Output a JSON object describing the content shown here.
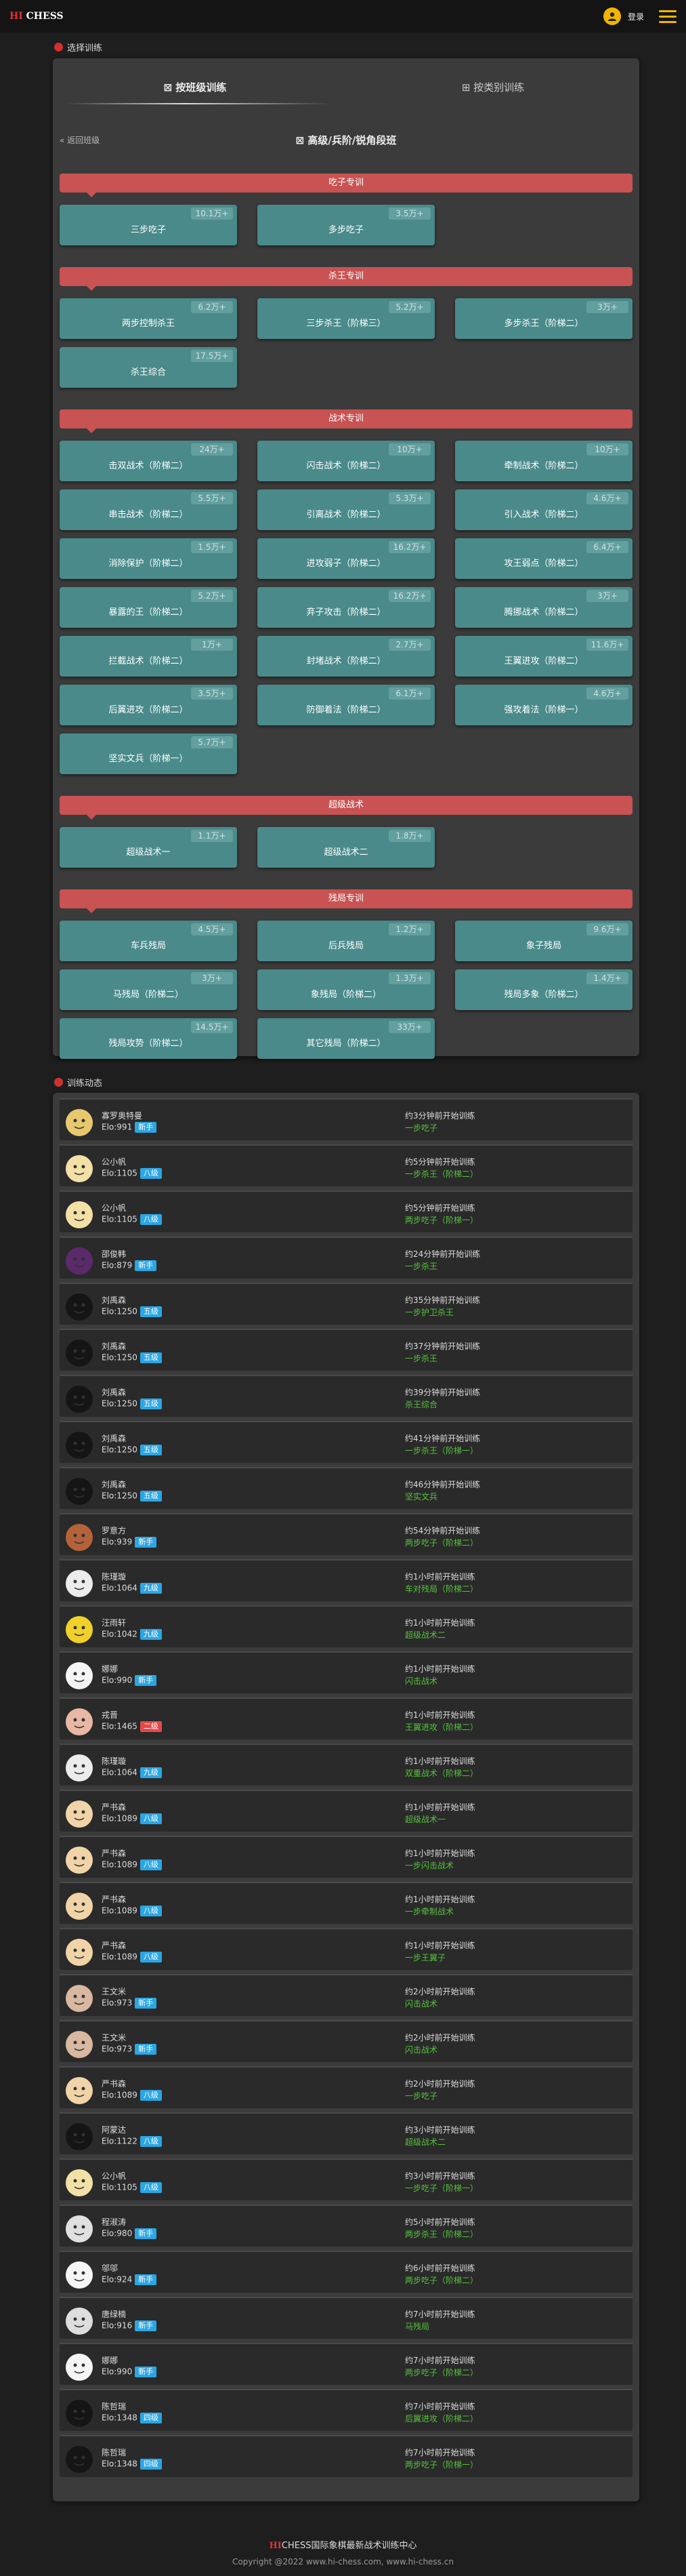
{
  "header": {
    "logo_hi": "HI",
    "logo_text": "CHESS",
    "login_label": "登录",
    "user_icon": "user-icon",
    "menu_icon": "hamburger-menu-icon"
  },
  "training": {
    "section_title": "选择训练",
    "tabs": [
      {
        "label": "按班级训练",
        "active": true
      },
      {
        "label": "按类别训练",
        "active": false
      }
    ],
    "back_label": "返回班级",
    "level_title": "高级/兵阶/锐角段班",
    "categories": [
      {
        "name": "吃子专训",
        "items": [
          {
            "label": "三步吃子",
            "badge": "10.1万+"
          },
          {
            "label": "多步吃子",
            "badge": "3.5万+"
          }
        ]
      },
      {
        "name": "杀王专训",
        "items": [
          {
            "label": "两步控制杀王",
            "badge": "6.2万+"
          },
          {
            "label": "三步杀王（阶梯三）",
            "badge": "5.2万+"
          },
          {
            "label": "多步杀王（阶梯二）",
            "badge": "3万+"
          },
          {
            "label": "杀王综合",
            "badge": "17.5万+"
          }
        ]
      },
      {
        "name": "战术专训",
        "items": [
          {
            "label": "击双战术（阶梯二）",
            "badge": "24万+"
          },
          {
            "label": "闪击战术（阶梯二）",
            "badge": "10万+"
          },
          {
            "label": "牵制战术（阶梯二）",
            "badge": "10万+"
          },
          {
            "label": "串击战术（阶梯二）",
            "badge": "5.5万+"
          },
          {
            "label": "引离战术（阶梯二）",
            "badge": "5.3万+"
          },
          {
            "label": "引入战术（阶梯二）",
            "badge": "4.6万+"
          },
          {
            "label": "消除保护（阶梯二）",
            "badge": "1.5万+"
          },
          {
            "label": "进攻弱子（阶梯二）",
            "badge": "16.2万+"
          },
          {
            "label": "攻王弱点（阶梯二）",
            "badge": "6.4万+"
          },
          {
            "label": "暴露的王（阶梯二）",
            "badge": "5.2万+"
          },
          {
            "label": "弃子攻击（阶梯二）",
            "badge": "16.2万+"
          },
          {
            "label": "腾挪战术（阶梯二）",
            "badge": "3万+"
          },
          {
            "label": "拦截战术（阶梯二）",
            "badge": "1万+"
          },
          {
            "label": "封堵战术（阶梯二）",
            "badge": "2.7万+"
          },
          {
            "label": "王翼进攻（阶梯二）",
            "badge": "11.6万+"
          },
          {
            "label": "后翼进攻（阶梯二）",
            "badge": "3.5万+"
          },
          {
            "label": "防御着法（阶梯二）",
            "badge": "6.1万+"
          },
          {
            "label": "强攻着法（阶梯一）",
            "badge": "4.6万+"
          },
          {
            "label": "坚实文兵（阶梯一）",
            "badge": "5.7万+"
          }
        ]
      },
      {
        "name": "超级战术",
        "items": [
          {
            "label": "超级战术一",
            "badge": "1.1万+"
          },
          {
            "label": "超级战术二",
            "badge": "1.8万+"
          }
        ]
      },
      {
        "name": "残局专训",
        "items": [
          {
            "label": "车兵残局",
            "badge": "4.5万+"
          },
          {
            "label": "后兵残局",
            "badge": "1.2万+"
          },
          {
            "label": "象子残局",
            "badge": "9.6万+"
          },
          {
            "label": "马残局（阶梯二）",
            "badge": "3万+"
          },
          {
            "label": "象残局（阶梯二）",
            "badge": "1.3万+"
          },
          {
            "label": "残局多象（阶梯二）",
            "badge": "1.4万+"
          },
          {
            "label": "残局攻势（阶梯二）",
            "badge": "14.5万+"
          },
          {
            "label": "其它残局（阶梯二）",
            "badge": "33万+"
          }
        ]
      }
    ]
  },
  "activity": {
    "section_title": "训练动态",
    "rows": [
      {
        "name": "寡罗奥特曼",
        "elo": "Elo:991",
        "level": "新手",
        "time": "约3分钟前开始训练",
        "topic": "一步吃子"
      },
      {
        "name": "公小帆",
        "elo": "Elo:1105",
        "level": "八级",
        "time": "约5分钟前开始训练",
        "topic": "一步杀王（阶梯二）"
      },
      {
        "name": "公小帆",
        "elo": "Elo:1105",
        "level": "八级",
        "time": "约5分钟前开始训练",
        "topic": "两步吃子（阶梯一）"
      },
      {
        "name": "邵俊韩",
        "elo": "Elo:879",
        "level": "新手",
        "time": "约24分钟前开始训练",
        "topic": "一步杀王"
      },
      {
        "name": "刘禹森",
        "elo": "Elo:1250",
        "level": "五级",
        "time": "约35分钟前开始训练",
        "topic": "一步护卫杀王"
      },
      {
        "name": "刘禹森",
        "elo": "Elo:1250",
        "level": "五级",
        "time": "约37分钟前开始训练",
        "topic": "一步杀王"
      },
      {
        "name": "刘禹森",
        "elo": "Elo:1250",
        "level": "五级",
        "time": "约39分钟前开始训练",
        "topic": "杀王综合"
      },
      {
        "name": "刘禹森",
        "elo": "Elo:1250",
        "level": "五级",
        "time": "约41分钟前开始训练",
        "topic": "一步杀王（阶梯一）"
      },
      {
        "name": "刘禹森",
        "elo": "Elo:1250",
        "level": "五级",
        "time": "约46分钟前开始训练",
        "topic": "坚实文兵"
      },
      {
        "name": "罗意方",
        "elo": "Elo:939",
        "level": "新手",
        "time": "约54分钟前开始训练",
        "topic": "两步吃子（阶梯二）"
      },
      {
        "name": "陈瑾璇",
        "elo": "Elo:1064",
        "level": "九级",
        "time": "约1小时前开始训练",
        "topic": "车对残局（阶梯二）"
      },
      {
        "name": "汪雨轩",
        "elo": "Elo:1042",
        "level": "九级",
        "time": "约1小时前开始训练",
        "topic": "超级战术二"
      },
      {
        "name": "娜娜",
        "elo": "Elo:990",
        "level": "新手",
        "time": "约1小时前开始训练",
        "topic": "闪击战术"
      },
      {
        "name": "戎晋",
        "elo": "Elo:1465",
        "level": "二级",
        "time": "约1小时前开始训练",
        "topic": "王翼进攻（阶梯二）"
      },
      {
        "name": "陈瑾璇",
        "elo": "Elo:1064",
        "level": "九级",
        "time": "约1小时前开始训练",
        "topic": "双重战术（阶梯二）"
      },
      {
        "name": "严书森",
        "elo": "Elo:1089",
        "level": "八级",
        "time": "约1小时前开始训练",
        "topic": "超级战术一"
      },
      {
        "name": "严书森",
        "elo": "Elo:1089",
        "level": "八级",
        "time": "约1小时前开始训练",
        "topic": "一步闪击战术"
      },
      {
        "name": "严书森",
        "elo": "Elo:1089",
        "level": "八级",
        "time": "约1小时前开始训练",
        "topic": "一步牵制战术"
      },
      {
        "name": "严书森",
        "elo": "Elo:1089",
        "level": "八级",
        "time": "约1小时前开始训练",
        "topic": "一步王翼子"
      },
      {
        "name": "王文米",
        "elo": "Elo:973",
        "level": "新手",
        "time": "约2小时前开始训练",
        "topic": "闪击战术"
      },
      {
        "name": "王文米",
        "elo": "Elo:973",
        "level": "新手",
        "time": "约2小时前开始训练",
        "topic": "闪击战术"
      },
      {
        "name": "严书森",
        "elo": "Elo:1089",
        "level": "八级",
        "time": "约2小时前开始训练",
        "topic": "一步吃子"
      },
      {
        "name": "阿蒙达",
        "elo": "Elo:1122",
        "level": "八级",
        "time": "约3小时前开始训练",
        "topic": "超级战术二"
      },
      {
        "name": "公小帆",
        "elo": "Elo:1105",
        "level": "八级",
        "time": "约3小时前开始训练",
        "topic": "一步吃子（阶梯一）"
      },
      {
        "name": "程淑涛",
        "elo": "Elo:980",
        "level": "新手",
        "time": "约5小时前开始训练",
        "topic": "两步杀王（阶梯二）"
      },
      {
        "name": "邬邬",
        "elo": "Elo:924",
        "level": "新手",
        "time": "约6小时前开始训练",
        "topic": "两步吃子（阶梯二）"
      },
      {
        "name": "唐绿楠",
        "elo": "Elo:916",
        "level": "新手",
        "time": "约7小时前开始训练",
        "topic": "马残局"
      },
      {
        "name": "娜娜",
        "elo": "Elo:990",
        "level": "新手",
        "time": "约7小时前开始训练",
        "topic": "两步吃子（阶梯二）"
      },
      {
        "name": "陈哲瑞",
        "elo": "Elo:1348",
        "level": "四级",
        "time": "约7小时前开始训练",
        "topic": "后翼进攻（阶梯二）"
      },
      {
        "name": "陈哲瑞",
        "elo": "Elo:1348",
        "level": "四级",
        "time": "约7小时前开始训练",
        "topic": "两步吃子（阶梯一）"
      }
    ]
  },
  "footer": {
    "brand_hi": "HI",
    "brand_text": "CHESS国际象棋最新战术训练中心",
    "copyright": "Copyright @2022 www.hi-chess.com, www.hi-chess.cn"
  },
  "colors": {
    "accent_red": "#c95252",
    "card_teal": "#4a8a8a",
    "topic_green": "#56c13d",
    "level_blue": "#2ba6e3",
    "level_red": "#e34a4a",
    "gold": "#f0b400"
  }
}
